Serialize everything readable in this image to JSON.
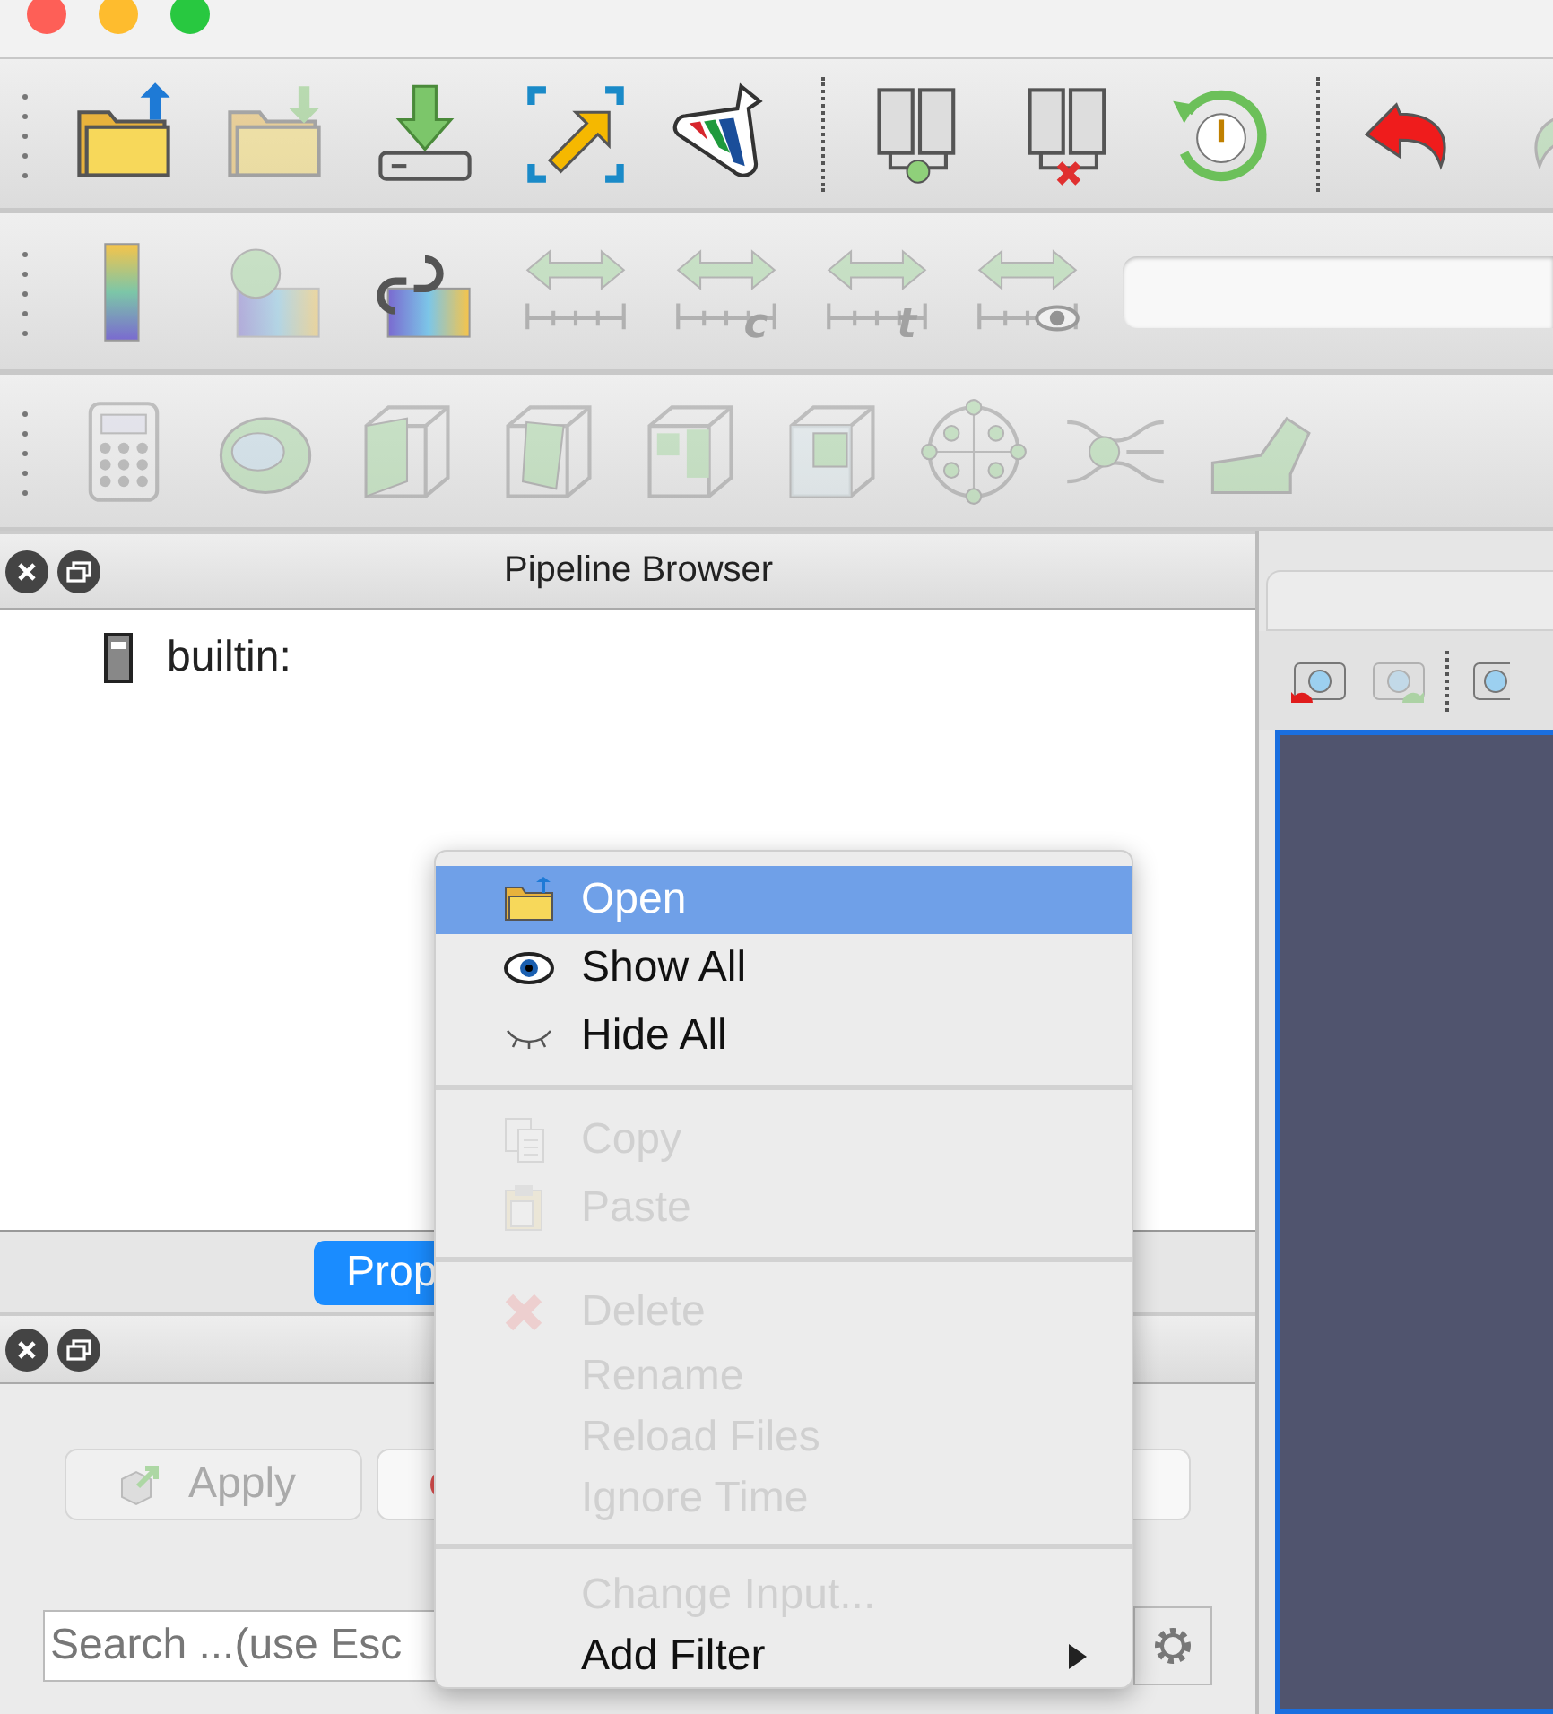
{
  "toolbars": [
    {
      "items": [
        {
          "kind": "open",
          "disabled": false
        },
        {
          "kind": "save",
          "disabled": true
        },
        {
          "kind": "download",
          "disabled": false
        },
        {
          "kind": "select",
          "disabled": false
        },
        {
          "kind": "flask",
          "disabled": false
        },
        {
          "kind": "separator"
        },
        {
          "kind": "connect",
          "disabled": false
        },
        {
          "kind": "disconnect",
          "disabled": false
        },
        {
          "kind": "timer",
          "disabled": false
        },
        {
          "kind": "separator"
        },
        {
          "kind": "undo",
          "disabled": false
        },
        {
          "kind": "redo",
          "disabled": true
        }
      ]
    },
    {
      "items": [
        {
          "kind": "colorbar",
          "disabled": false
        },
        {
          "kind": "legend",
          "disabled": true
        },
        {
          "kind": "link",
          "disabled": false
        },
        {
          "kind": "range",
          "disabled": true
        },
        {
          "kind": "range",
          "disabled": true,
          "badge": "c"
        },
        {
          "kind": "range",
          "disabled": true,
          "badge": "t"
        },
        {
          "kind": "range-eye",
          "disabled": true
        }
      ]
    },
    {
      "items": [
        {
          "kind": "calculator",
          "disabled": true
        },
        {
          "kind": "contour",
          "disabled": true
        },
        {
          "kind": "clip",
          "disabled": true
        },
        {
          "kind": "slice",
          "disabled": true
        },
        {
          "kind": "threshold",
          "disabled": true
        },
        {
          "kind": "subset",
          "disabled": true
        },
        {
          "kind": "glyph",
          "disabled": true
        },
        {
          "kind": "stream",
          "disabled": true
        },
        {
          "kind": "warp",
          "disabled": true
        }
      ]
    }
  ],
  "pipeline_browser": {
    "title": "Pipeline Browser",
    "items": [
      {
        "label": "builtin:"
      }
    ]
  },
  "properties": {
    "tabs": [
      {
        "label": "Prop",
        "selected": true
      }
    ],
    "buttons": [
      {
        "label": "Apply",
        "disabled": true
      }
    ],
    "search": {
      "placeholder": "Search ...(use Esc"
    }
  },
  "context_menu": {
    "items": [
      {
        "kind": "open",
        "label": "Open",
        "selected": true,
        "disabled": false
      },
      {
        "kind": "show",
        "label": "Show All",
        "selected": false,
        "disabled": false
      },
      {
        "kind": "hide",
        "label": "Hide All",
        "selected": false,
        "disabled": false
      },
      {
        "kind": "separator"
      },
      {
        "kind": "copy",
        "label": "Copy",
        "selected": false,
        "disabled": true
      },
      {
        "kind": "paste",
        "label": "Paste",
        "selected": false,
        "disabled": true
      },
      {
        "kind": "separator"
      },
      {
        "kind": "delete",
        "label": "Delete",
        "selected": false,
        "disabled": true
      },
      {
        "kind": "plain",
        "label": "Rename",
        "selected": false,
        "disabled": true
      },
      {
        "kind": "plain",
        "label": "Reload Files",
        "selected": false,
        "disabled": true
      },
      {
        "kind": "plain",
        "label": "Ignore Time",
        "selected": false,
        "disabled": true
      },
      {
        "kind": "separator"
      },
      {
        "kind": "plain",
        "label": "Change Input...",
        "selected": false,
        "disabled": true
      },
      {
        "kind": "submenu",
        "label": "Add Filter",
        "selected": false,
        "disabled": false
      }
    ]
  }
}
